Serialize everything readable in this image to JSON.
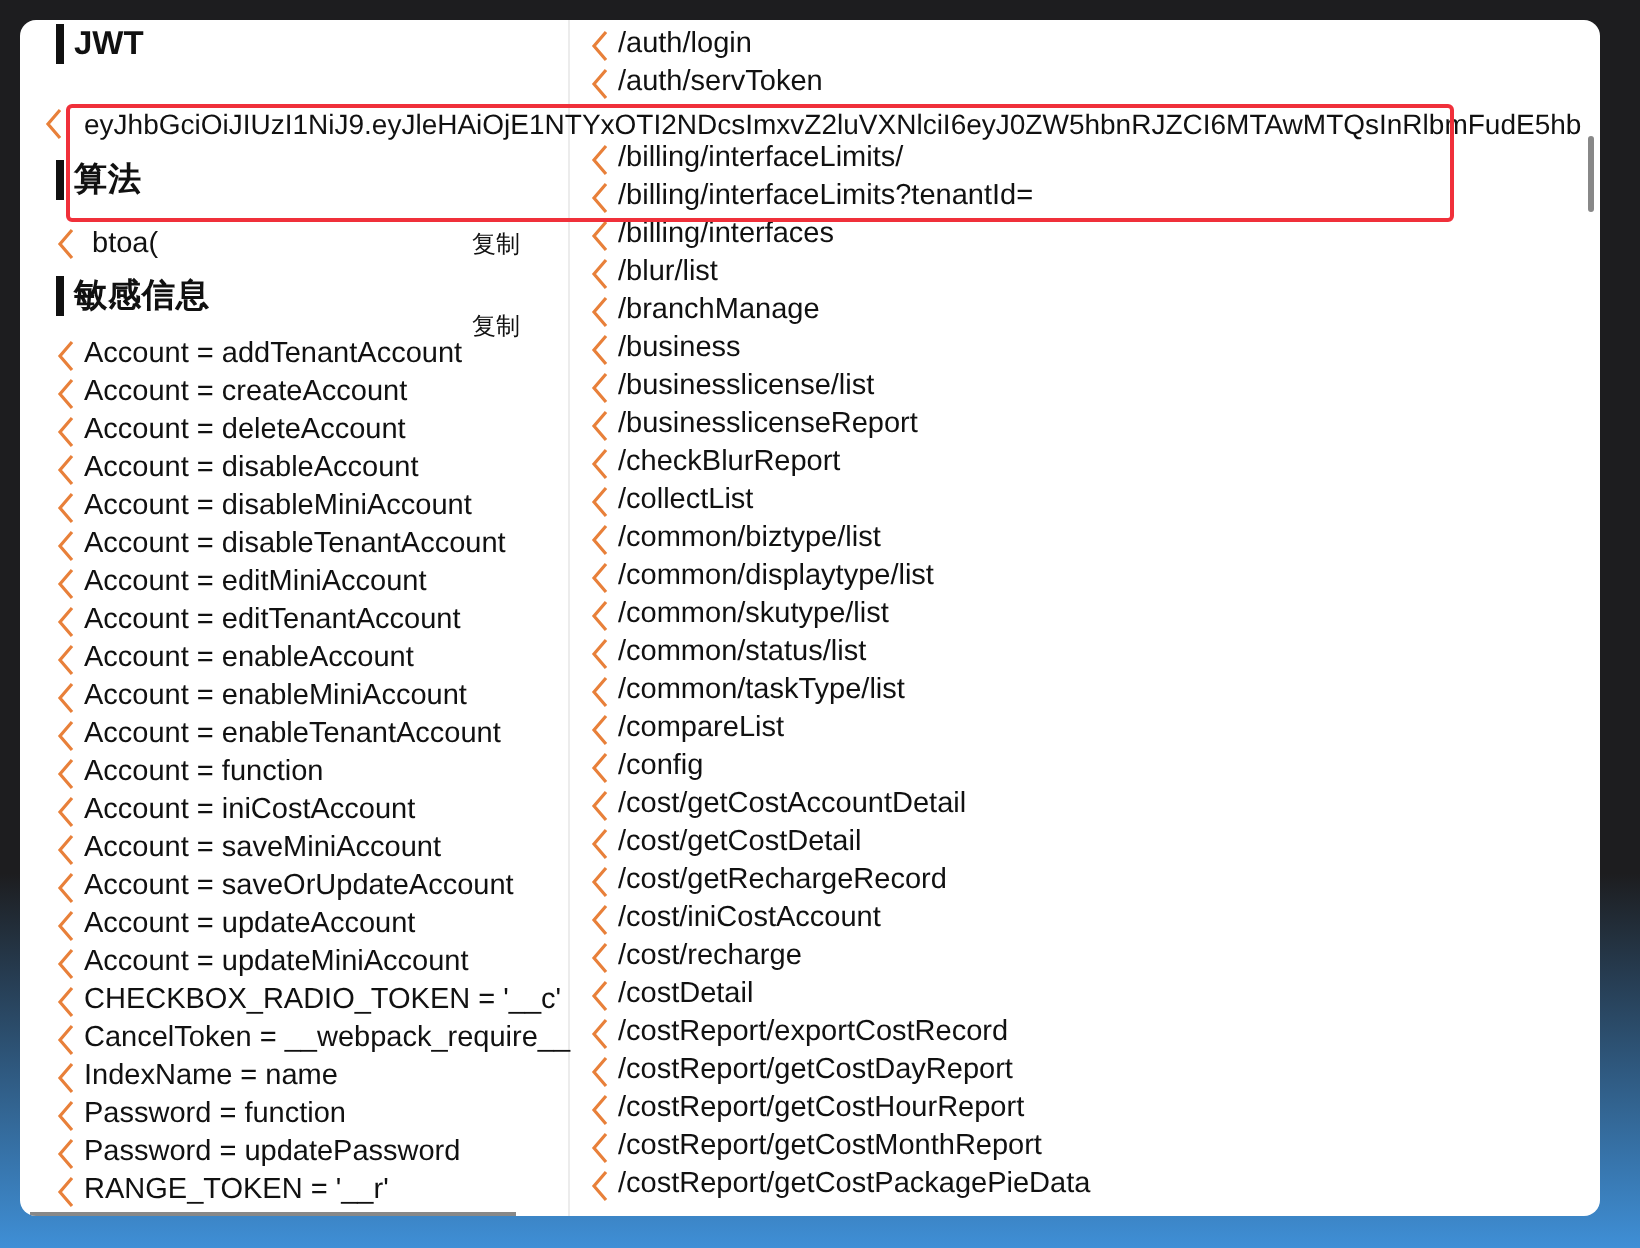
{
  "sections": [
    {
      "kind": "jwt",
      "title": "JWT",
      "items": [
        "eyJhbGciOiJIUzI1NiJ9.eyJleHAiOjE1NTYxOTI2NDcsImxvZ2luVXNlciI6eyJ0ZW5hbnRJZCI6MTAwMTQsInRlbmFudE5hb"
      ]
    },
    {
      "kind": "algo",
      "title": "算法",
      "copy_label": "复制",
      "items": [
        "btoa("
      ]
    },
    {
      "kind": "sensitive",
      "title": "敏感信息",
      "copy_label": "复制",
      "items": [
        "Account = addTenantAccount",
        "Account = createAccount",
        "Account = deleteAccount",
        "Account = disableAccount",
        "Account = disableMiniAccount",
        "Account = disableTenantAccount",
        "Account = editMiniAccount",
        "Account = editTenantAccount",
        "Account = enableAccount",
        "Account = enableMiniAccount",
        "Account = enableTenantAccount",
        "Account = function",
        "Account = iniCostAccount",
        "Account = saveMiniAccount",
        "Account = saveOrUpdateAccount",
        "Account = updateAccount",
        "Account = updateMiniAccount",
        "CHECKBOX_RADIO_TOKEN = '__c'",
        "CancelToken = __webpack_require__",
        "IndexName = name",
        "Password = function",
        "Password = updatePassword",
        "RANGE_TOKEN = '__r'"
      ]
    }
  ],
  "paths": [
    "/auth/login",
    "/auth/servToken",
    "/billing/interfaceLimits/",
    "/billing/interfaceLimits?tenantId=",
    "/billing/interfaces",
    "/blur/list",
    "/branchManage",
    "/business",
    "/businesslicense/list",
    "/businesslicenseReport",
    "/checkBlurReport",
    "/collectList",
    "/common/biztype/list",
    "/common/displaytype/list",
    "/common/skutype/list",
    "/common/status/list",
    "/common/taskType/list",
    "/compareList",
    "/config",
    "/cost/getCostAccountDetail",
    "/cost/getCostDetail",
    "/cost/getRechargeRecord",
    "/cost/iniCostAccount",
    "/cost/recharge",
    "/costDetail",
    "/costReport/exportCostRecord",
    "/costReport/getCostDayReport",
    "/costReport/getCostHourReport",
    "/costReport/getCostMonthReport",
    "/costReport/getCostPackagePieData"
  ]
}
